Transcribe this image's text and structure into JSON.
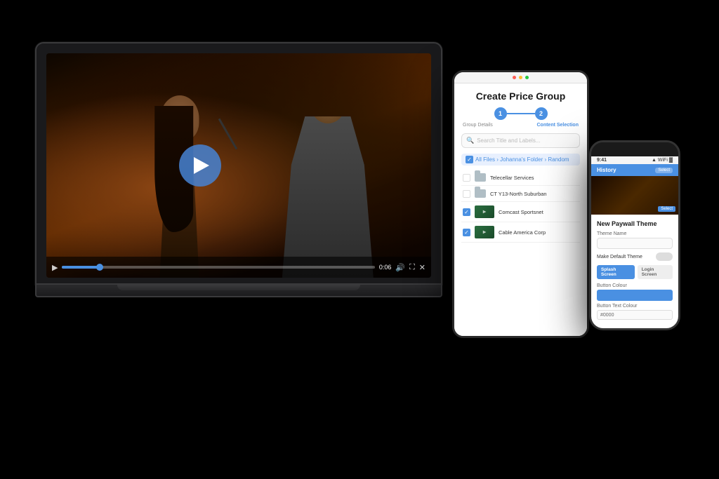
{
  "scene": {
    "background": "#000000"
  },
  "laptop": {
    "video": {
      "play_button_visible": true
    },
    "controls": {
      "time": "0:06",
      "progress_percent": 12
    }
  },
  "tablet": {
    "title": "Create Price Group",
    "stepper": {
      "step1_label": "Group Details",
      "step2_label": "Content Selection",
      "step1_active": true,
      "step2_active": true
    },
    "search": {
      "placeholder": "Search Title and Labels..."
    },
    "breadcrumb": "All Files › Johanna's Folder › Random",
    "files": [
      {
        "name": "Telecellar Services",
        "type": "folder",
        "checked": false
      },
      {
        "name": "CT Y13-North Suburban",
        "type": "folder",
        "checked": false
      },
      {
        "name": "Comcast Sportsnet",
        "type": "video",
        "checked": true
      },
      {
        "name": "Cable America Corp",
        "type": "video",
        "checked": true
      }
    ]
  },
  "phone": {
    "status_bar": {
      "time": "9:41",
      "icons": "▲ WiFi Batt"
    },
    "header": {
      "title": "History",
      "button": "Select"
    },
    "video_preview": {
      "overlay_text": "Select"
    },
    "body": {
      "section_title": "New Paywall Theme",
      "theme_name_label": "Theme Name",
      "default_toggle_label": "Make Default Theme",
      "tab1": "Splash Screen",
      "tab2": "Login Screen",
      "button_colour_label": "Button Colour",
      "button_colour_value": "#ffffff",
      "button_text_colour_label": "Button Text Colour",
      "button_text_colour_value": "#0000"
    }
  },
  "icons": {
    "play": "▶",
    "folder": "📁",
    "search": "🔍",
    "check": "✓"
  }
}
